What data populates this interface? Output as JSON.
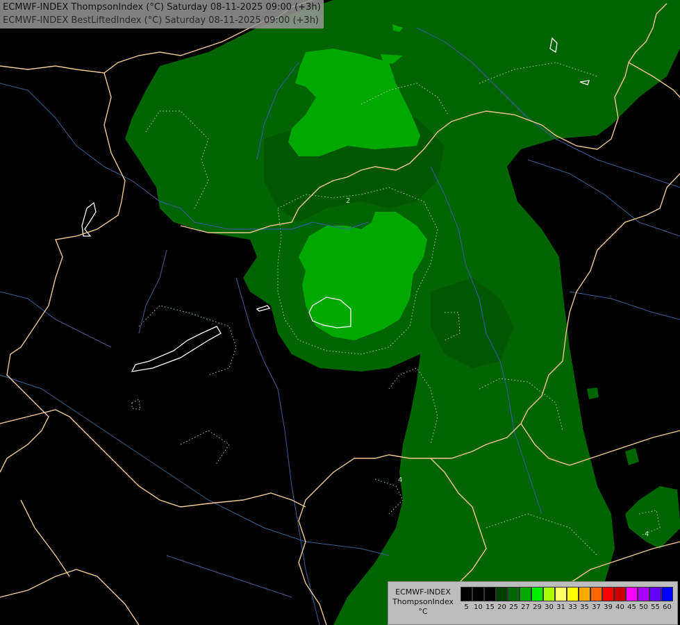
{
  "header": {
    "line1": "ECMWF-INDEX ThompsonIndex (°C) Saturday 08-11-2025 09:00 (+3h)",
    "line2": "ECMWF-INDEX BestLiftedIndex (°C) Saturday 08-11-2025 09:00 (+3h)"
  },
  "legend": {
    "model": "ECMWF-INDEX",
    "field": "ThompsonIndex",
    "unit": "°C",
    "classes": [
      {
        "label": "5",
        "color": "#000000"
      },
      {
        "label": "10",
        "color": "#000000"
      },
      {
        "label": "15",
        "color": "#000000"
      },
      {
        "label": "20",
        "color": "#003d00"
      },
      {
        "label": "25",
        "color": "#006400"
      },
      {
        "label": "27",
        "color": "#00aa00"
      },
      {
        "label": "29",
        "color": "#00ee00"
      },
      {
        "label": "30",
        "color": "#aaff00"
      },
      {
        "label": "31",
        "color": "#ffff66"
      },
      {
        "label": "33",
        "color": "#ffff00"
      },
      {
        "label": "35",
        "color": "#ffaa00"
      },
      {
        "label": "37",
        "color": "#ff6600"
      },
      {
        "label": "39",
        "color": "#ff0000"
      },
      {
        "label": "40",
        "color": "#cc0000"
      },
      {
        "label": "45",
        "color": "#ff00ff"
      },
      {
        "label": "50",
        "color": "#aa00ff"
      },
      {
        "label": "55",
        "color": "#6600ff"
      },
      {
        "label": "60",
        "color": "#0000ff"
      }
    ]
  },
  "map": {
    "contour_labels": [
      "2",
      "4",
      "4"
    ],
    "colors": {
      "background": "#000000",
      "dark_green": "#006400",
      "medium_green": "#00aa00",
      "border": "#f0c890",
      "river": "#3b5f9c"
    }
  }
}
